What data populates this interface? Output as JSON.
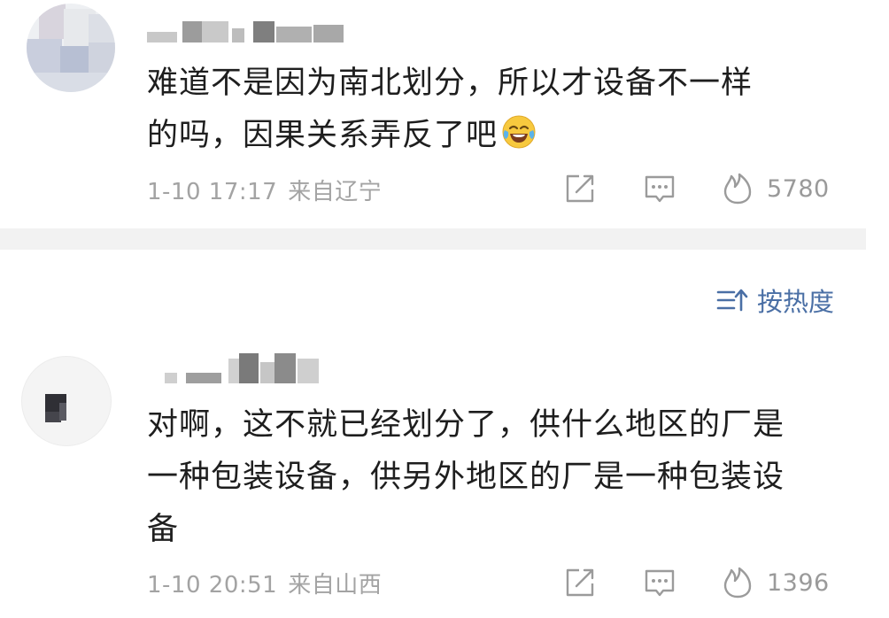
{
  "comments": [
    {
      "text_lines": [
        "难道不是因为南北划分，所以才设备不一样",
        "的吗，因果关系弄反了吧"
      ],
      "emoji": "laugh-cry-emoji",
      "date": "1-10 17:17",
      "location": "来自辽宁",
      "likes": "5780"
    },
    {
      "text_lines": [
        "对啊，这不就已经划分了，供什么地区的厂是",
        "一种包装设备，供另外地区的厂是一种包装设",
        "备"
      ],
      "date": "1-10 20:51",
      "location": "来自山西",
      "likes": "1396"
    }
  ],
  "sort": {
    "label": "按热度",
    "icon": "sort-icon"
  },
  "colors": {
    "text": "#1e1e1e",
    "meta": "#a3a3a3",
    "accent": "#4a6fa5",
    "divider": "#f2f2f2"
  }
}
